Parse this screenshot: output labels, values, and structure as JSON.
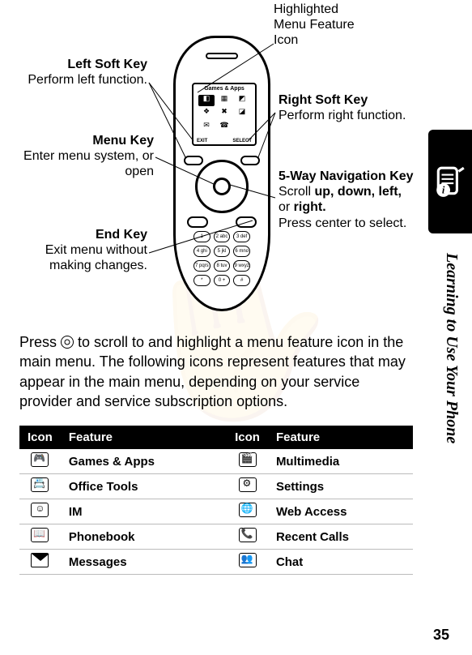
{
  "callouts": {
    "highlighted": {
      "title": "Highlighted Menu Feature Icon"
    },
    "left_soft": {
      "title": "Left Soft Key",
      "desc": "Perform left function."
    },
    "right_soft": {
      "title": "Right Soft Key",
      "desc": "Perform right function."
    },
    "menu_key": {
      "title": "Menu Key",
      "desc": "Enter menu system, or open"
    },
    "nav5": {
      "title": "5-Way Navigation Key",
      "desc1": "Scroll ",
      "bold": "up, down, left, ",
      "mid": "or ",
      "bold2": "right.",
      "desc2": "Press center to select."
    },
    "end_key": {
      "title": "End Key",
      "desc": "Exit menu without making changes."
    }
  },
  "phone_screen": {
    "title": "Games & Apps",
    "soft_left": "EXIT",
    "soft_right": "SELECT"
  },
  "keypad": [
    "1",
    "2 abc",
    "3 def",
    "4 ghi",
    "5 jkl",
    "6 mno",
    "7 pqrs",
    "8 tuv",
    "9 wxyz",
    "*",
    "0 +",
    "#"
  ],
  "body": {
    "p1a": "Press ",
    "p1b": " to scroll to and highlight a menu feature icon in the main menu. The following icons represent features that may appear in the main menu, depending on your service provider and service subscription options."
  },
  "table": {
    "headers": [
      "Icon",
      "Feature",
      "Icon",
      "Feature"
    ],
    "rows": [
      {
        "icon1": "games",
        "feat1": "Games & Apps",
        "icon2": "multimedia",
        "feat2": "Multimedia"
      },
      {
        "icon1": "office",
        "feat1": "Office Tools",
        "icon2": "settings",
        "feat2": "Settings"
      },
      {
        "icon1": "im",
        "feat1": "IM",
        "icon2": "web",
        "feat2": "Web Access"
      },
      {
        "icon1": "phonebook",
        "feat1": "Phonebook",
        "icon2": "recent",
        "feat2": "Recent Calls"
      },
      {
        "icon1": "messages",
        "feat1": "Messages",
        "icon2": "chat",
        "feat2": "Chat"
      }
    ]
  },
  "side_text": "Learning to Use Your Phone",
  "page_number": "35"
}
